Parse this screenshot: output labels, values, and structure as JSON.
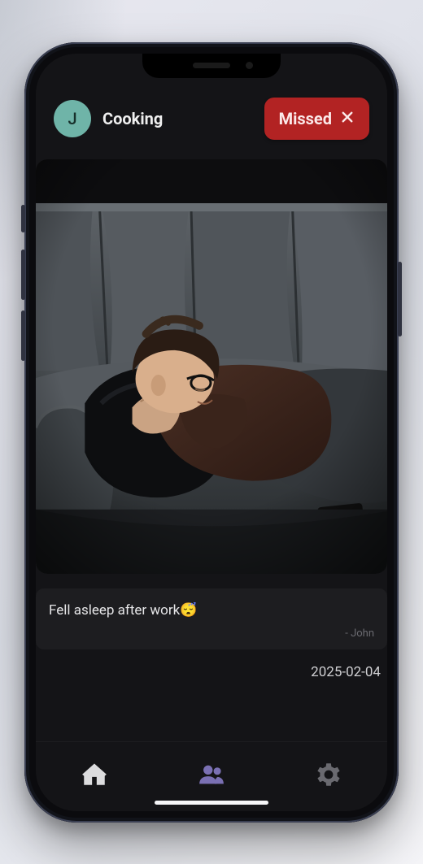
{
  "header": {
    "avatar_initial": "J",
    "title": "Cooking",
    "missed_label": "Missed"
  },
  "post": {
    "image_alt": "Person lying on a grey couch with a black pillow, wearing glasses and a brown sweater, resting their head on their hands.",
    "note_text": "Fell asleep after work😴",
    "note_author": "- John",
    "date": "2025-02-04"
  },
  "nav": {
    "home": "home",
    "people": "people",
    "settings": "settings"
  },
  "colors": {
    "avatar_bg": "#6fb4a8",
    "missed_bg": "#b22323",
    "accent_purple": "#7a70b3",
    "screen_bg": "#141417"
  }
}
